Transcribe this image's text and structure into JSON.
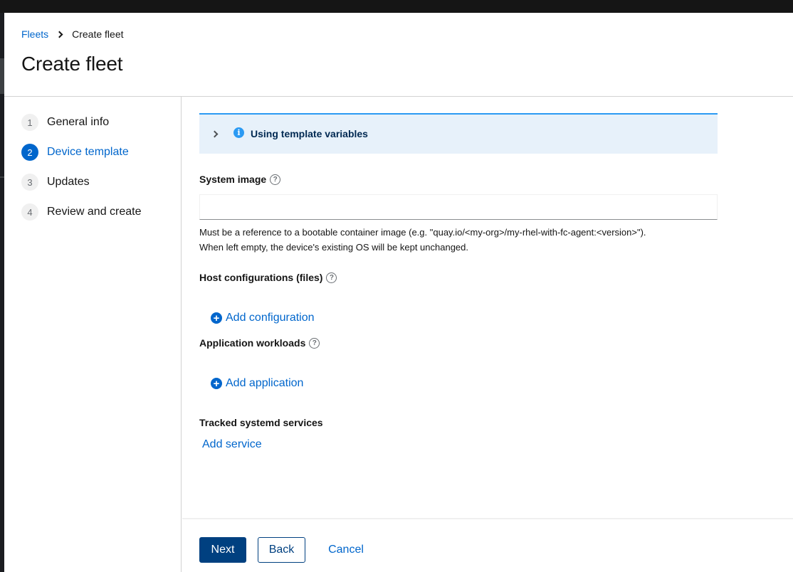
{
  "breadcrumb": {
    "parent": "Fleets",
    "current": "Create fleet"
  },
  "page_title": "Create fleet",
  "wizard_steps": [
    {
      "num": "1",
      "label": "General info",
      "active": false
    },
    {
      "num": "2",
      "label": "Device template",
      "active": true
    },
    {
      "num": "3",
      "label": "Updates",
      "active": false
    },
    {
      "num": "4",
      "label": "Review and create",
      "active": false
    }
  ],
  "alert": {
    "title": "Using template variables",
    "icon": "info-icon",
    "expanded": false
  },
  "system_image": {
    "label": "System image",
    "value": "",
    "placeholder": "",
    "helper_line1": "Must be a reference to a bootable container image (e.g. \"quay.io/<my-org>/my-rhel-with-fc-agent:<version>\").",
    "helper_line2": "When left empty, the device's existing OS will be kept unchanged."
  },
  "host_configurations": {
    "label": "Host configurations (files)",
    "add_label": "Add configuration"
  },
  "application_workloads": {
    "label": "Application workloads",
    "add_label": "Add application"
  },
  "tracked_services": {
    "label": "Tracked systemd services",
    "add_label": "Add service"
  },
  "footer": {
    "next_label": "Next",
    "back_label": "Back",
    "cancel_label": "Cancel"
  },
  "colors": {
    "accent": "#0066cc",
    "primary_button": "#004080",
    "alert_bg": "#e7f1fa",
    "alert_border": "#2b9af3"
  }
}
